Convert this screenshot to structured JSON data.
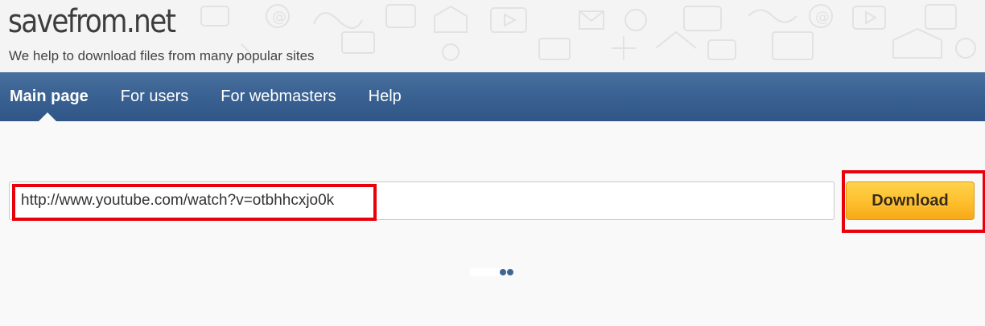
{
  "header": {
    "logo_text": "savefrom.net",
    "tagline": "We help to download files from many popular sites"
  },
  "nav": {
    "items": [
      {
        "label": "Main page",
        "active": true
      },
      {
        "label": "For users",
        "active": false
      },
      {
        "label": "For webmasters",
        "active": false
      },
      {
        "label": "Help",
        "active": false
      }
    ]
  },
  "form": {
    "url_value": "http://www.youtube.com/watch?v=otbhhcxjo0k",
    "download_label": "Download"
  },
  "colors": {
    "nav_bg": "#3a6292",
    "highlight": "#e8000b",
    "button": "#fdbe2c",
    "loader_dot": "#3f6494"
  },
  "icons": [
    "loading-dots-icon"
  ]
}
